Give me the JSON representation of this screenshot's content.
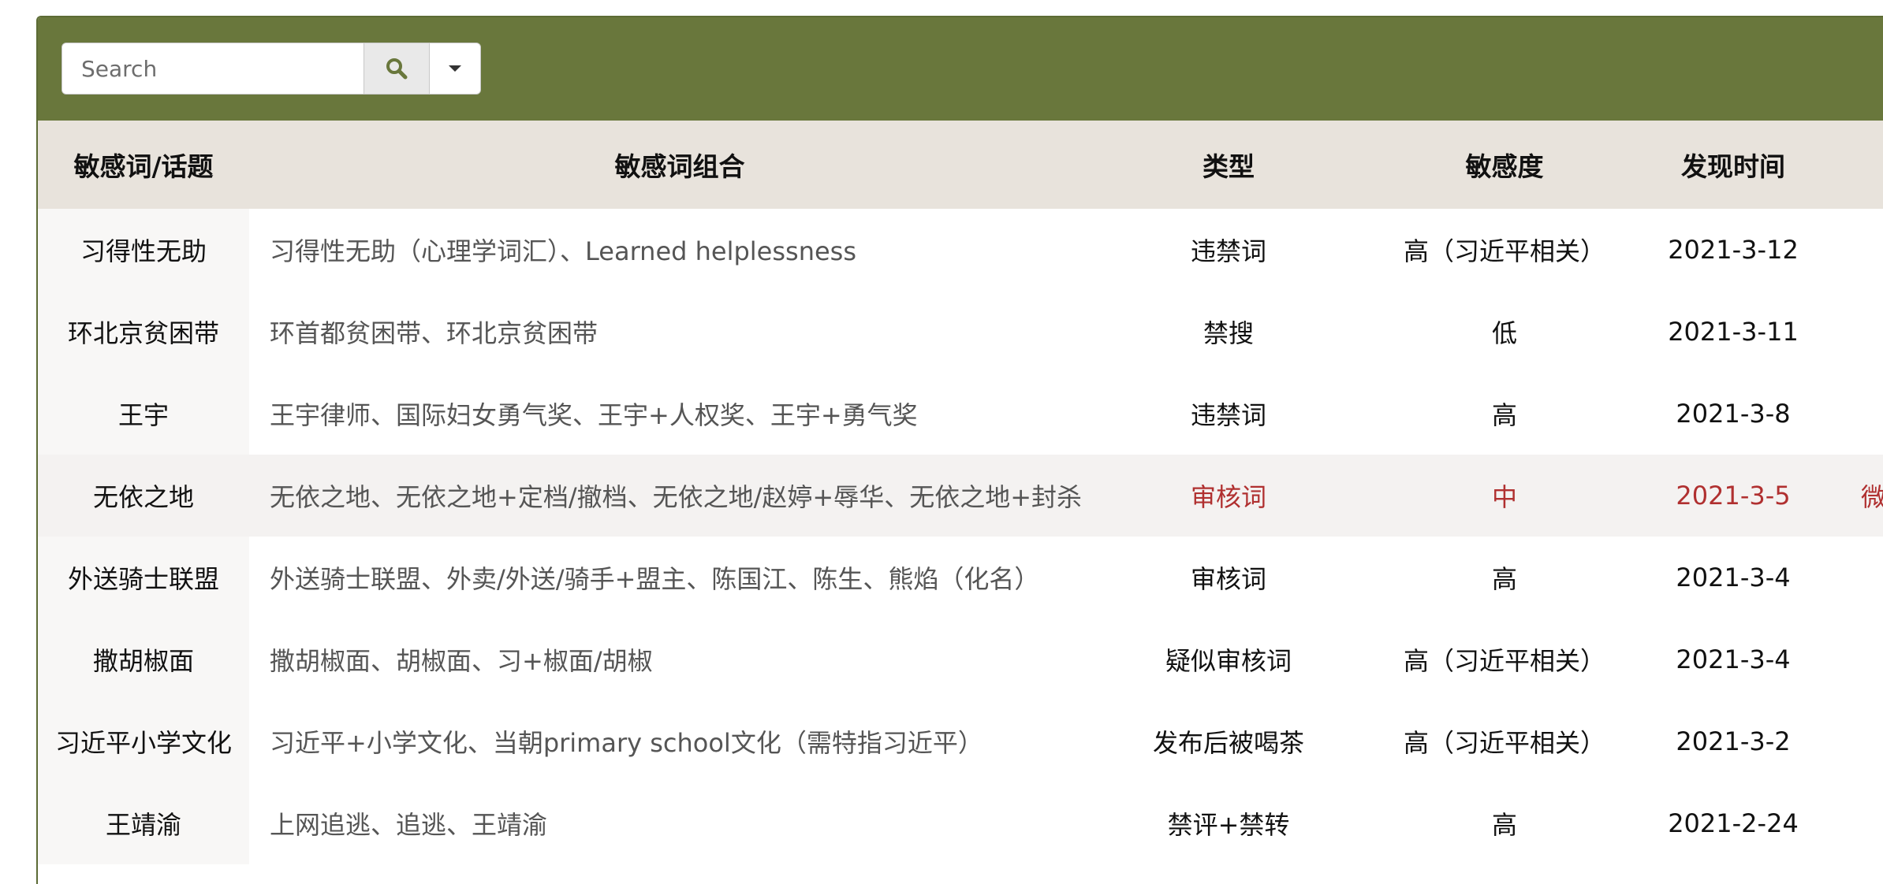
{
  "search": {
    "placeholder": "Search"
  },
  "icons": {
    "search": "search-icon",
    "dropdown": "caret-down-icon"
  },
  "colors": {
    "toolbar": "#69773c",
    "header": "#e8e3dc",
    "highlight_text": "#b03030"
  },
  "columns": [
    "敏感词/话题",
    "敏感词组合",
    "类型",
    "敏感度",
    "发现时间"
  ],
  "rows": [
    {
      "term": "习得性无助",
      "combo": "习得性无助（心理学词汇）、Learned helplessness",
      "type": "违禁词",
      "level": "高（习近平相关）",
      "date": "2021-3-12",
      "extra": ""
    },
    {
      "term": "环北京贫困带",
      "combo": "环首都贫困带、环北京贫困带",
      "type": "禁搜",
      "level": "低",
      "date": "2021-3-11",
      "extra": ""
    },
    {
      "term": "王宇",
      "combo": "王宇律师、国际妇女勇气奖、王宇+人权奖、王宇+勇气奖",
      "type": "违禁词",
      "level": "高",
      "date": "2021-3-8",
      "extra": ""
    },
    {
      "term": "无依之地",
      "combo": "无依之地、无依之地+定档/撤档、无依之地/赵婷+辱华、无依之地+封杀",
      "type": "审核词",
      "level": "中",
      "date": "2021-3-5",
      "extra": "微"
    },
    {
      "term": "外送骑士联盟",
      "combo": "外送骑士联盟、外卖/外送/骑手+盟主、陈国江、陈生、熊焰（化名）",
      "type": "审核词",
      "level": "高",
      "date": "2021-3-4",
      "extra": ""
    },
    {
      "term": "撒胡椒面",
      "combo": "撒胡椒面、胡椒面、习+椒面/胡椒",
      "type": "疑似审核词",
      "level": "高（习近平相关）",
      "date": "2021-3-4",
      "extra": ""
    },
    {
      "term": "习近平小学文化",
      "combo": "习近平+小学文化、当朝primary school文化（需特指习近平）",
      "type": "发布后被喝茶",
      "level": "高（习近平相关）",
      "date": "2021-3-2",
      "extra": ""
    },
    {
      "term": "王靖渝",
      "combo": "上网追逃、追逃、王靖渝",
      "type": "禁评+禁转",
      "level": "高",
      "date": "2021-2-24",
      "extra": ""
    }
  ]
}
